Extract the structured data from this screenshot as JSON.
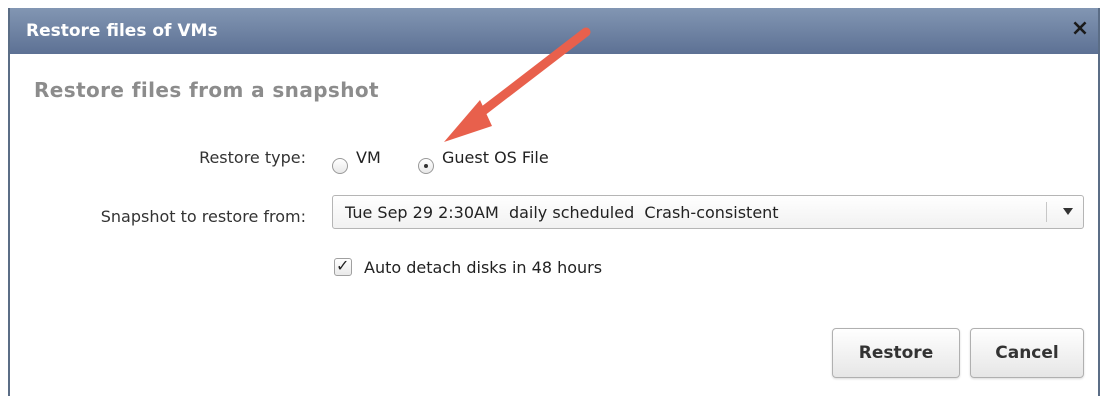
{
  "window": {
    "title": "Restore files of VMs",
    "close_glyph": "×"
  },
  "section": {
    "subtitle": "Restore files from a snapshot"
  },
  "restore_type": {
    "label": "Restore type:",
    "options": [
      {
        "label": "VM",
        "selected": false
      },
      {
        "label": "Guest OS File",
        "selected": true
      }
    ]
  },
  "snapshot": {
    "label": "Snapshot to restore from:",
    "selected_value": "Tue Sep 29 2:30AM  daily scheduled  Crash-consistent"
  },
  "auto_detach": {
    "label": "Auto detach disks in 48 hours",
    "checked": true,
    "check_glyph": "✓"
  },
  "buttons": {
    "restore_label": "Restore",
    "cancel_label": "Cancel"
  },
  "colors": {
    "titlebar_top": "#8296b3",
    "titlebar_bottom": "#5d7194",
    "annotation_arrow": "#e8604c"
  },
  "icons": {
    "close": "close-icon",
    "dropdown": "chevron-down-icon",
    "check": "check-icon",
    "annotation": "arrow-annotation-icon"
  }
}
